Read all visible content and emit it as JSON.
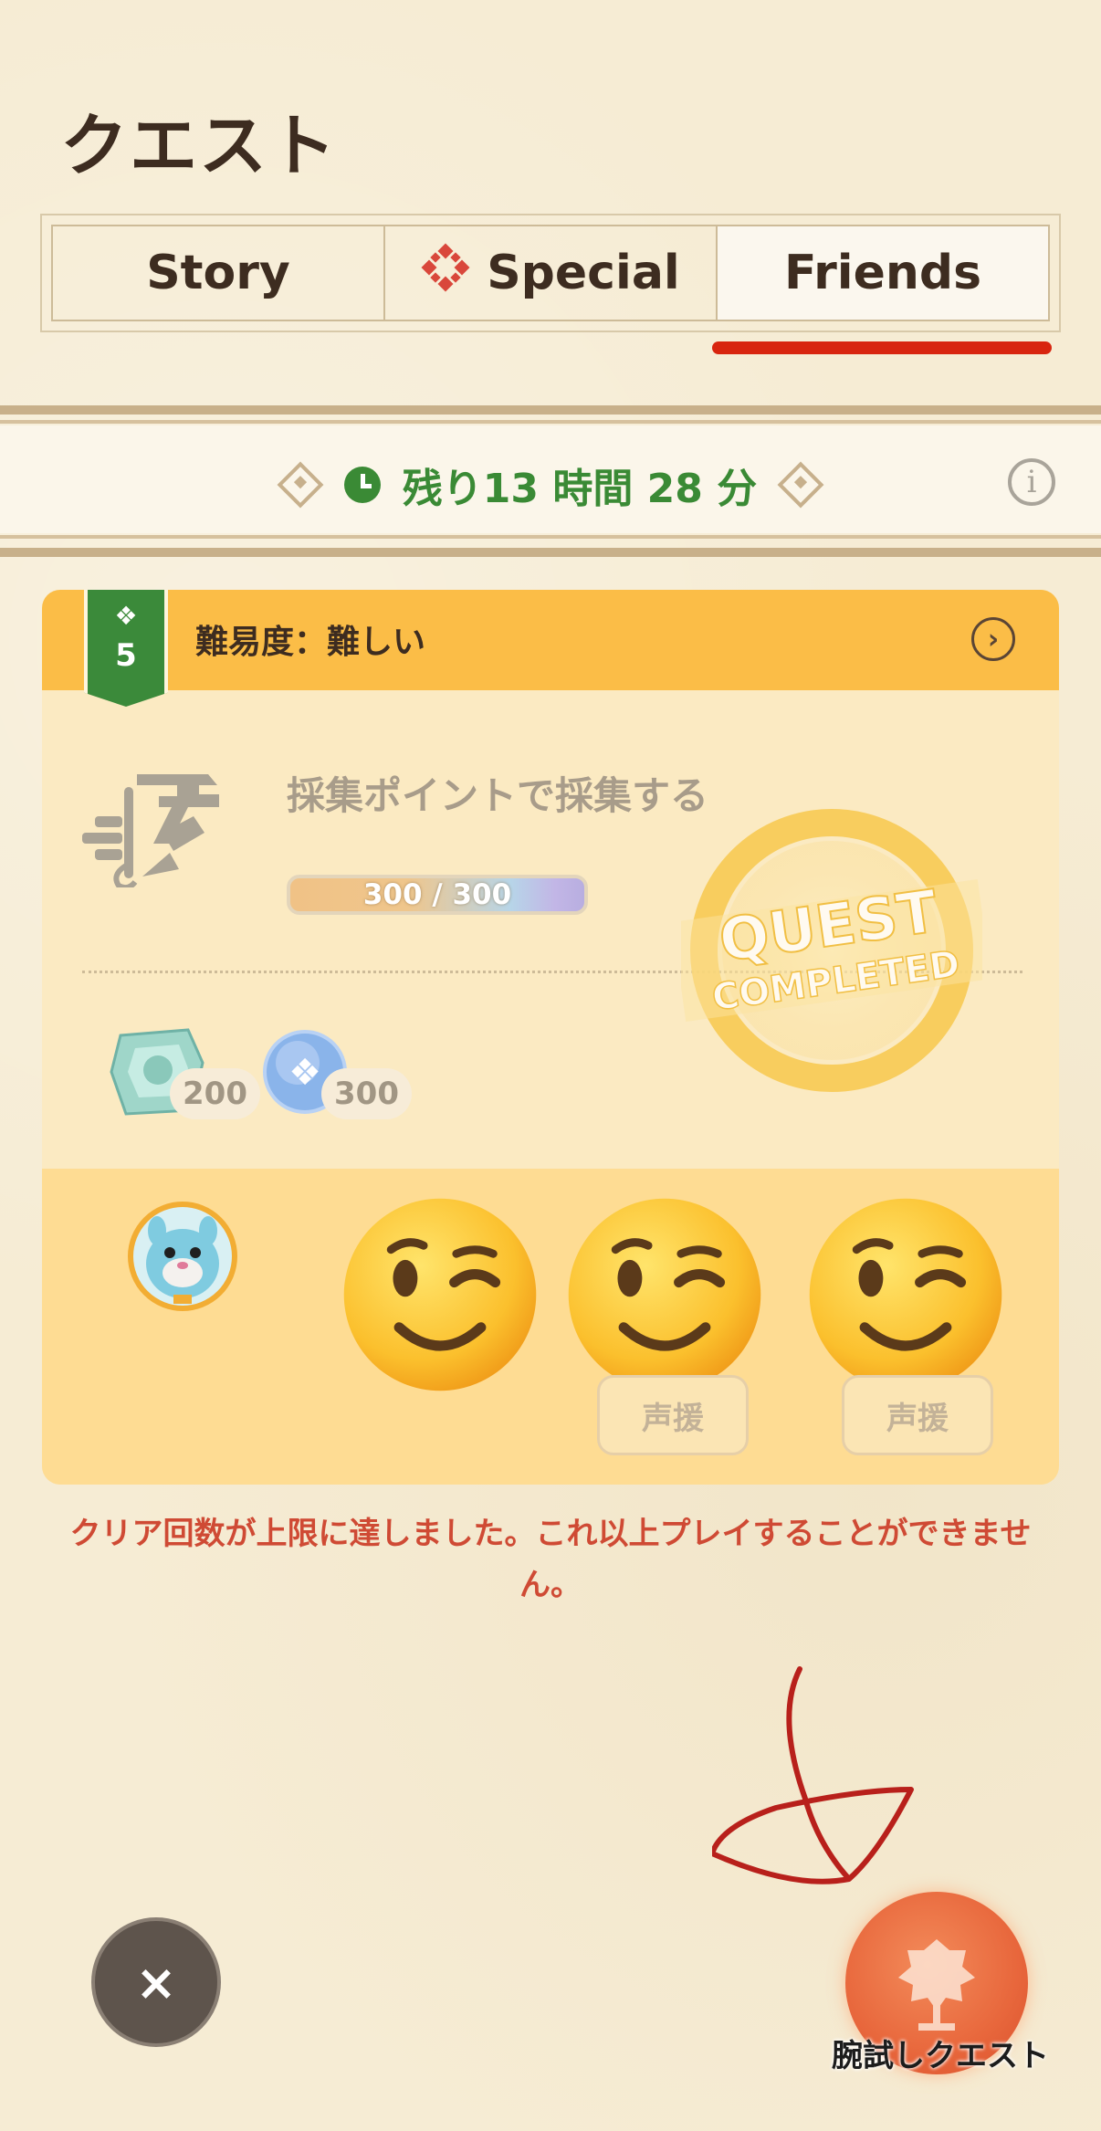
{
  "header": {
    "title": "クエスト"
  },
  "tabs": [
    {
      "label": "Story"
    },
    {
      "label": "Special",
      "icon": "special-flower-icon"
    },
    {
      "label": "Friends",
      "active": true
    }
  ],
  "timer": {
    "text": "残り13 時間 28 分"
  },
  "quest_card": {
    "difficulty_level": "5",
    "difficulty_label": "難易度：難しい",
    "objective": "採集ポイントで採集する",
    "progress_text": "300 / 300",
    "progress": 1.0,
    "stamp_line1": "QUEST",
    "stamp_line2": "COMPLETED",
    "rewards": [
      {
        "icon": "crystal-reward-icon",
        "amount": "200"
      },
      {
        "icon": "snowflake-orb-reward-icon",
        "amount": "300"
      }
    ],
    "cheer_label": "声援"
  },
  "limit_message": "クリア回数が上限に達しました。これ以上プレイすることができません。",
  "bottom": {
    "close_label": "×",
    "quest_button_label": "腕試しクエスト"
  },
  "colors": {
    "accent_red": "#d8250f",
    "header_orange": "#fbbd47",
    "timer_green": "#3a8a35",
    "warning_text": "#cf4a34"
  }
}
